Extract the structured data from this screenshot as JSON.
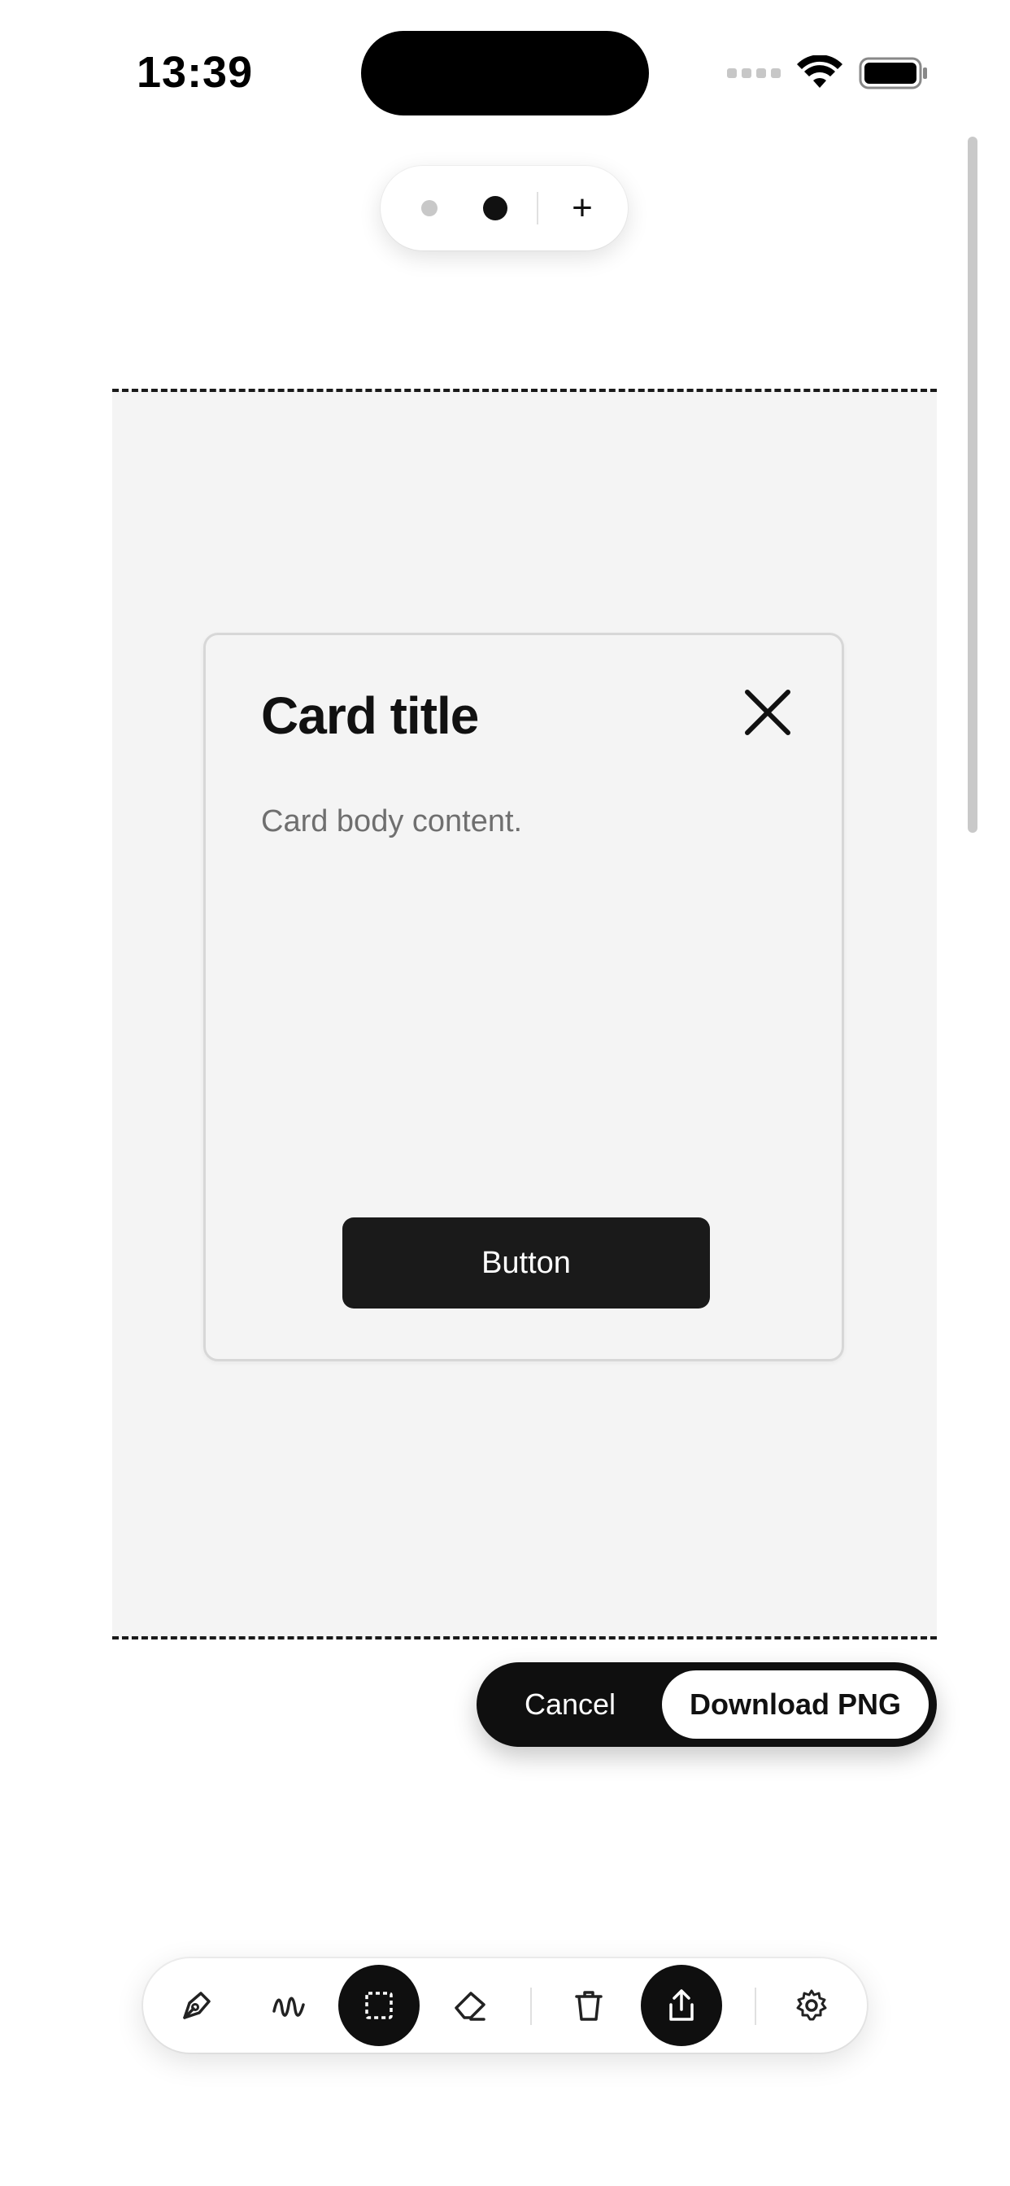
{
  "status_bar": {
    "time": "13:39"
  },
  "size_selector": {
    "add_label": "+"
  },
  "card": {
    "title": "Card title",
    "body": "Card body content.",
    "button_label": "Button"
  },
  "export_bar": {
    "cancel_label": "Cancel",
    "download_label": "Download PNG"
  },
  "toolbar": {
    "tools": [
      {
        "icon": "pen-icon",
        "active": false
      },
      {
        "icon": "squiggle-icon",
        "active": false
      },
      {
        "icon": "selection-icon",
        "active": true
      },
      {
        "icon": "eraser-icon",
        "active": false
      },
      {
        "icon": "trash-icon",
        "active": false
      },
      {
        "icon": "share-icon",
        "active": true
      },
      {
        "icon": "settings-icon",
        "active": false
      }
    ]
  },
  "colors": {
    "accent": "#0f0f0f",
    "canvas_bg": "#f4f4f4",
    "card_border": "#d7d7d7"
  }
}
